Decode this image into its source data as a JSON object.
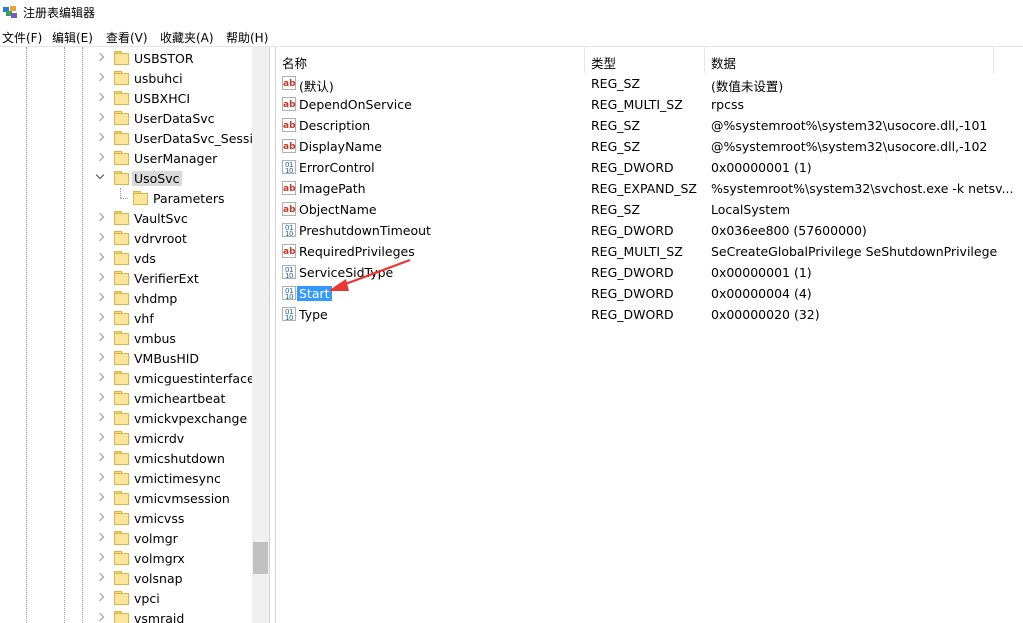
{
  "window": {
    "title": "注册表编辑器",
    "icon": "regedit-icon"
  },
  "menu": [
    {
      "label": "文件(F)"
    },
    {
      "label": "编辑(E)"
    },
    {
      "label": "查看(V)"
    },
    {
      "label": "收藏夹(A)"
    },
    {
      "label": "帮助(H)"
    }
  ],
  "tree": {
    "items": [
      {
        "label": "USBSTOR"
      },
      {
        "label": "usbuhci"
      },
      {
        "label": "USBXHCI"
      },
      {
        "label": "UserDataSvc"
      },
      {
        "label": "UserDataSvc_Session"
      },
      {
        "label": "UserManager"
      },
      {
        "label": "UsoSvc",
        "expanded": true,
        "selected": true
      },
      {
        "label": "Parameters",
        "child": true
      },
      {
        "label": "VaultSvc"
      },
      {
        "label": "vdrvroot"
      },
      {
        "label": "vds"
      },
      {
        "label": "VerifierExt"
      },
      {
        "label": "vhdmp"
      },
      {
        "label": "vhf"
      },
      {
        "label": "vmbus"
      },
      {
        "label": "VMBusHID"
      },
      {
        "label": "vmicguestinterface"
      },
      {
        "label": "vmicheartbeat"
      },
      {
        "label": "vmickvpexchange"
      },
      {
        "label": "vmicrdv"
      },
      {
        "label": "vmicshutdown"
      },
      {
        "label": "vmictimesync"
      },
      {
        "label": "vmicvmsession"
      },
      {
        "label": "vmicvss"
      },
      {
        "label": "volmgr"
      },
      {
        "label": "volmgrx"
      },
      {
        "label": "volsnap"
      },
      {
        "label": "vpci"
      },
      {
        "label": "vsmraid"
      }
    ]
  },
  "values": {
    "columns": {
      "name": "名称",
      "type": "类型",
      "data": "数据"
    },
    "rows": [
      {
        "name": "(默认)",
        "type": "REG_SZ",
        "data": "(数值未设置)",
        "icon": "string-value-icon"
      },
      {
        "name": "DependOnService",
        "type": "REG_MULTI_SZ",
        "data": "rpcss",
        "icon": "string-value-icon"
      },
      {
        "name": "Description",
        "type": "REG_SZ",
        "data": "@%systemroot%\\system32\\usocore.dll,-101",
        "icon": "string-value-icon"
      },
      {
        "name": "DisplayName",
        "type": "REG_SZ",
        "data": "@%systemroot%\\system32\\usocore.dll,-102",
        "icon": "string-value-icon"
      },
      {
        "name": "ErrorControl",
        "type": "REG_DWORD",
        "data": "0x00000001 (1)",
        "icon": "binary-value-icon"
      },
      {
        "name": "ImagePath",
        "type": "REG_EXPAND_SZ",
        "data": "%systemroot%\\system32\\svchost.exe -k netsv...",
        "icon": "string-value-icon"
      },
      {
        "name": "ObjectName",
        "type": "REG_SZ",
        "data": "LocalSystem",
        "icon": "string-value-icon"
      },
      {
        "name": "PreshutdownTimeout",
        "type": "REG_DWORD",
        "data": "0x036ee800 (57600000)",
        "icon": "binary-value-icon"
      },
      {
        "name": "RequiredPrivileges",
        "type": "REG_MULTI_SZ",
        "data": "SeCreateGlobalPrivilege SeShutdownPrivilege",
        "icon": "string-value-icon"
      },
      {
        "name": "ServiceSidType",
        "type": "REG_DWORD",
        "data": "0x00000001 (1)",
        "icon": "binary-value-icon"
      },
      {
        "name": "Start",
        "type": "REG_DWORD",
        "data": "0x00000004 (4)",
        "icon": "binary-value-icon",
        "selected": true
      },
      {
        "name": "Type",
        "type": "REG_DWORD",
        "data": "0x00000020 (32)",
        "icon": "binary-value-icon"
      }
    ]
  },
  "colors": {
    "selection": "#3399ff",
    "tree_selection": "#d9d9d9",
    "annotation_arrow": "#e53935"
  }
}
